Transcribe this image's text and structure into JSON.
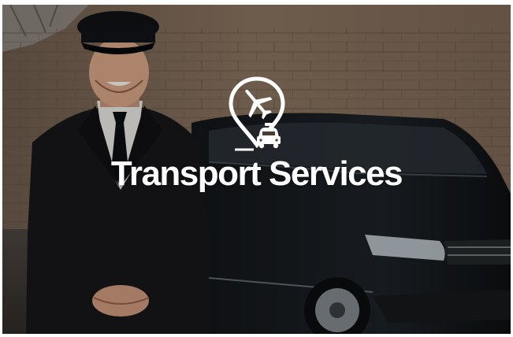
{
  "service_card": {
    "title": "Transport Services",
    "icon": "airport-taxi-pin-icon",
    "photo": "chauffeur-beside-black-van-photo",
    "text_color": "#ffffff"
  }
}
